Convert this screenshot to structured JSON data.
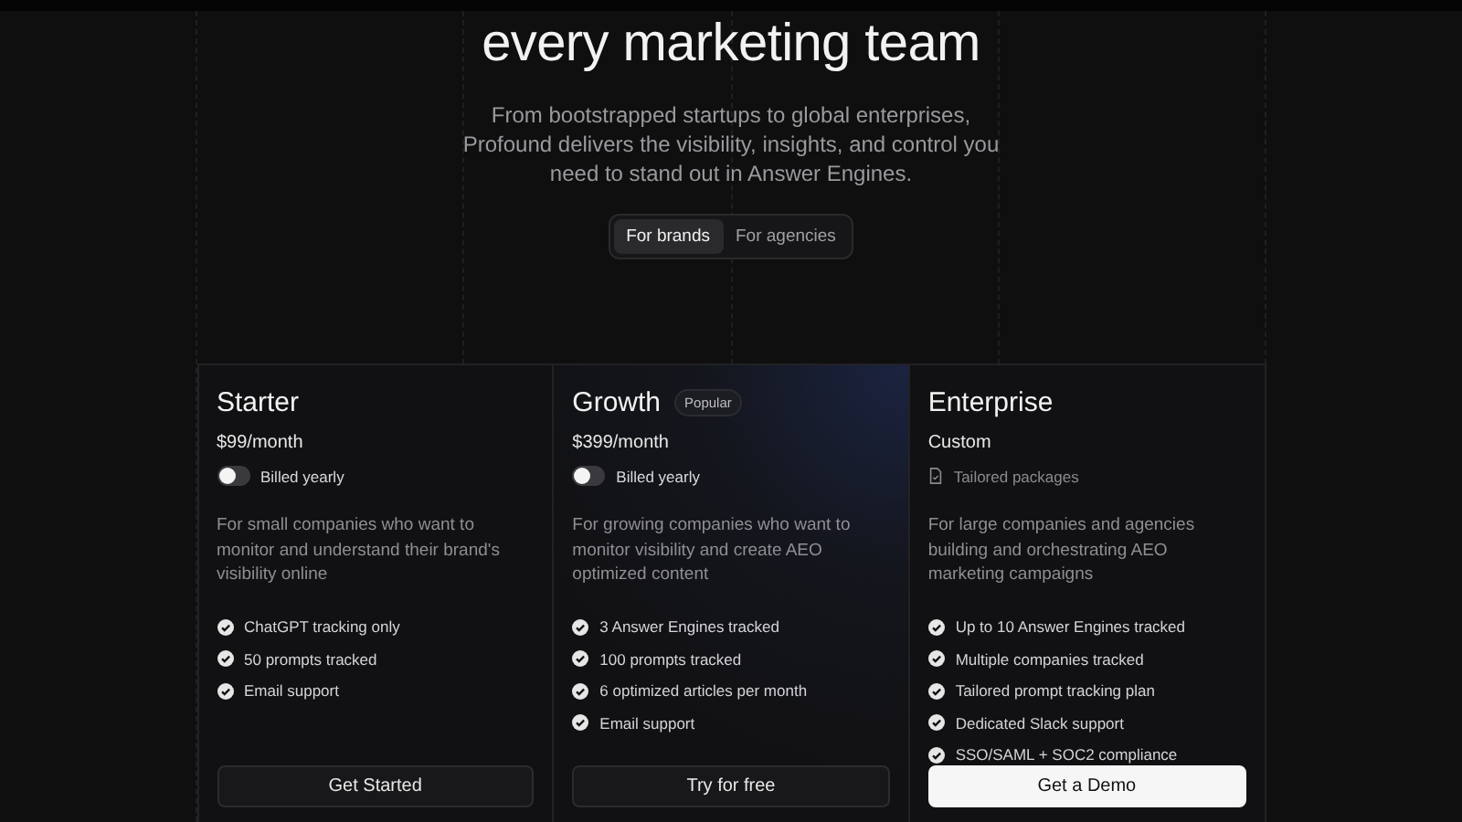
{
  "hero": {
    "title": "every marketing team",
    "subtitle": "From bootstrapped startups to global enterprises, Profound delivers the visibility, insights, and control you need to stand out in Answer Engines."
  },
  "audience_tabs": [
    {
      "label": "For brands",
      "selected": true
    },
    {
      "label": "For agencies",
      "selected": false
    }
  ],
  "plans": [
    {
      "name": "Starter",
      "featured": false,
      "price": "$99/month",
      "billing": {
        "kind": "toggle",
        "label": "Billed yearly",
        "on": false
      },
      "description": "For small companies who want to monitor and understand their brand's visibility online",
      "features": [
        "ChatGPT tracking only",
        "50 prompts tracked",
        "Email support"
      ],
      "button": {
        "label": "Get Started",
        "primary": false
      }
    },
    {
      "name": "Growth",
      "badge": "Popular",
      "featured": true,
      "price": "$399/month",
      "billing": {
        "kind": "toggle",
        "label": "Billed yearly",
        "on": false
      },
      "description": "For growing companies who want to monitor visibility and create AEO optimized content",
      "features": [
        "3 Answer Engines tracked",
        "100 prompts tracked",
        "6 optimized articles per month",
        "Email support"
      ],
      "button": {
        "label": "Try for free",
        "primary": false
      }
    },
    {
      "name": "Enterprise",
      "featured": false,
      "price": "Custom",
      "billing": {
        "kind": "note",
        "label": "Tailored packages"
      },
      "description": "For large companies and agencies building and orchestrating AEO marketing campaigns",
      "features": [
        "Up to 10 Answer Engines tracked",
        "Multiple companies tracked",
        "Tailored prompt tracking plan",
        "Dedicated Slack support",
        "SSO/SAML + SOC2 compliance"
      ],
      "button": {
        "label": "Get a Demo",
        "primary": true
      }
    }
  ]
}
